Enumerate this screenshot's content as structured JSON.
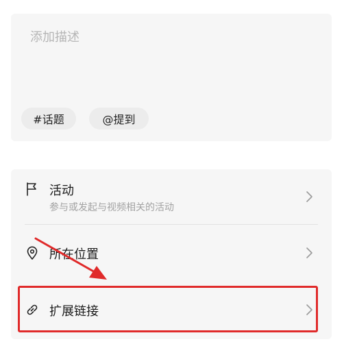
{
  "description": {
    "placeholder": "添加描述",
    "chips": [
      {
        "label": "#话题"
      },
      {
        "label": "@提到"
      }
    ]
  },
  "menu": {
    "items": [
      {
        "label": "活动",
        "subtitle": "参与或发起与视频相关的活动",
        "icon": "flag-icon"
      },
      {
        "label": "所在位置",
        "icon": "location-pin-icon"
      },
      {
        "label": "扩展链接",
        "icon": "link-icon"
      }
    ]
  },
  "colors": {
    "card_bg": "#f6f6f6",
    "placeholder": "#b5b5b5",
    "annotation_red": "#e02a2a"
  }
}
